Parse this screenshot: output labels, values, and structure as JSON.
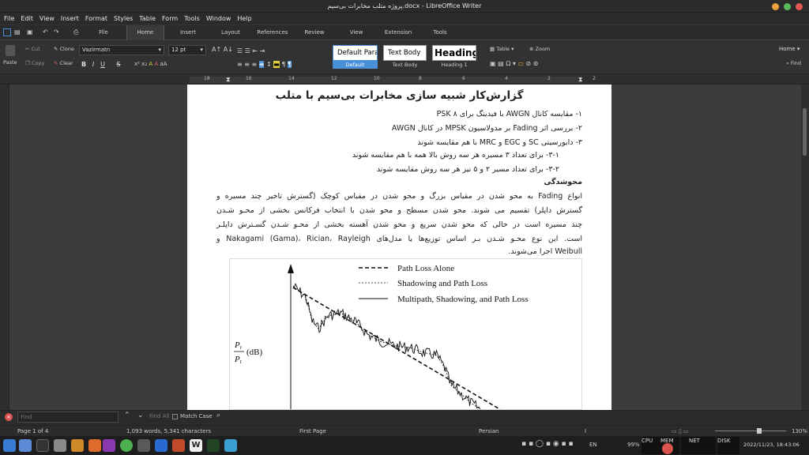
{
  "window": {
    "title": "پروژه متلب مخابرات بی‌سیم.docx - LibreOffice Writer"
  },
  "menu": [
    "File",
    "Edit",
    "View",
    "Insert",
    "Format",
    "Styles",
    "Table",
    "Form",
    "Tools",
    "Window",
    "Help"
  ],
  "tabs": {
    "file": "File",
    "home": "Home",
    "insert": "Insert",
    "layout": "Layout",
    "references": "References",
    "review": "Review",
    "view": "View",
    "extension": "Extension",
    "tools": "Tools"
  },
  "ribbon": {
    "cut": "Cut",
    "clone": "Clone",
    "paste": "Paste",
    "copy": "Copy",
    "clear": "Clear",
    "font_name": "Vazirmatn",
    "font_size": "12 pt",
    "bold": "B",
    "italic": "I",
    "underline": "U",
    "strike": "S",
    "style_default": "Default Parag",
    "style_default_label": "Default",
    "style_textbody": "Text Body",
    "style_textbody_label": "Text Body",
    "style_heading": "Heading",
    "style_heading_label": "Heading 1",
    "table": "Table",
    "zoom": "Zoom",
    "home_select": "Home",
    "find": "Find"
  },
  "ruler_numbers": [
    "18",
    "16",
    "14",
    "12",
    "10",
    "8",
    "6",
    "4",
    "2",
    "2"
  ],
  "document": {
    "title": "گزارش‌کار شبیه سازی مخابرات بی‌سیم با متلب",
    "items": [
      "۱- مقایسه کانال AWGN با فیدینگ برای PSK ۸",
      "۲- بررسی اثر Fading بر مدولاسیون MPSK در کانال AWGN",
      "۳- دایورسیتی SC و EGC و MRC با هم مقایسه شوند",
      "۳-۱- برای تعداد ۳ مسیره هر سه روش بالا همه با هم مقایسه شوند",
      "۳-۲- برای تعداد مسیر ۲ و ۵ نیز هر سه روش مقایسه شوند"
    ],
    "heading2": "محوشدگی",
    "paragraph": [
      "انواع Fading به محو شدن در مقیاس بزرگ و محو شدن در مقیاس کوچک (گسترش تاخیر چند مسیره و",
      "گسترش داپلر) تقسیم می شوند. محو شدن مسطح و محو شدن با انتخاب فرکانس بخشی از محـو شـدن",
      "چند مسیره است در حالی که محو شدن سریع و محو شدن آهسته بخشی از محـو شـدن گسـترش داپلـر",
      "است. این نوع محـو شـدن بـر اساس توزیع‌ها یا مدل‌های Nakagami (Gama)، Rician، Rayleigh و",
      "Weibull اجرا می‌شوند."
    ],
    "figure": {
      "legend": [
        "Path Loss Alone",
        "Shadowing and Path Loss",
        "Multipath, Shadowing, and Path Loss"
      ],
      "ylabel_num": "P",
      "ylabel_num_sub": "r",
      "ylabel_den": "P",
      "ylabel_den_sub": "t",
      "ylabel_unit": "(dB)"
    }
  },
  "findbar": {
    "placeholder": "Find",
    "find_all": "Find All",
    "match_case": "Match Case"
  },
  "status": {
    "page": "Page 1 of 4",
    "words": "1,093 words, 5,341 characters",
    "page_style": "First Page",
    "language": "Persian",
    "zoom": "130%"
  },
  "taskbar": {
    "battery": "99%",
    "lang": "EN",
    "datetime": "2022/11/23, 18:43:06",
    "cpu": "CPU",
    "mem": "MEM",
    "net": "NET",
    "disk": "DISK"
  },
  "colors": {
    "accent": "#4a90d9",
    "page": "#ffffff",
    "dark": "#2b2b2b"
  }
}
